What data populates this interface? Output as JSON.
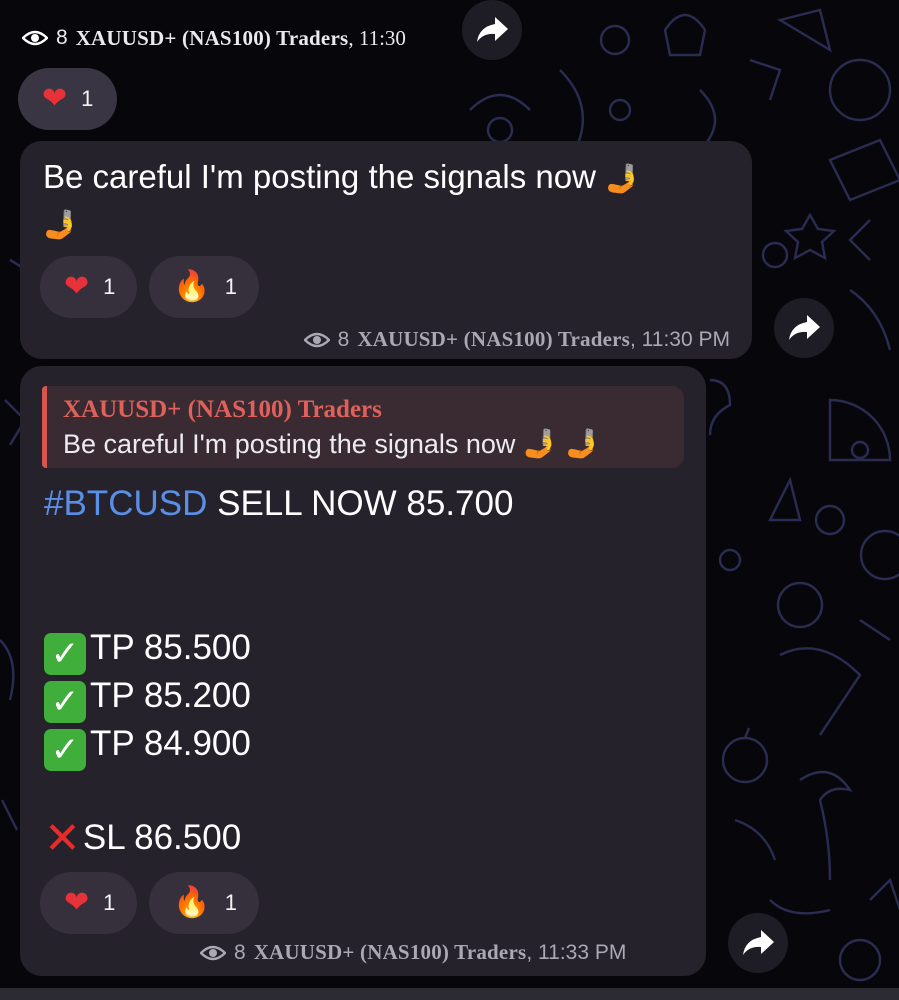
{
  "colors": {
    "background": "#07070b",
    "bubble": "#25222c",
    "accent_link": "#5a8fe8",
    "quote_accent": "#d7554f"
  },
  "top_meta": {
    "icon": "eye-icon",
    "views": "8",
    "channel": "XAUUSD+ (NAS100) Traders",
    "time": ", 11:30"
  },
  "top_reaction": {
    "icon": "heart-icon",
    "emoji": "❤",
    "count": "1"
  },
  "message1": {
    "text": "Be careful I'm posting the signals now",
    "trailing_emoji": "🤳",
    "reactions": [
      {
        "icon": "heart-icon",
        "emoji": "❤",
        "count": "1"
      },
      {
        "icon": "fire-icon",
        "emoji": "🔥",
        "count": "1"
      }
    ],
    "meta": {
      "views": "8",
      "channel": "XAUUSD+ (NAS100) Traders",
      "time": ", 11:30 PM"
    }
  },
  "message2": {
    "reply": {
      "author": "XAUUSD+ (NAS100) Traders",
      "text": "Be careful I'm posting the signals now"
    },
    "signal": {
      "hashtag": "#BTCUSD",
      "rest": " SELL NOW 85.700",
      "targets": [
        "TP 85.500",
        "TP 85.200",
        "TP 84.900"
      ],
      "stop_loss": "SL 86.500"
    },
    "reactions": [
      {
        "icon": "heart-icon",
        "emoji": "❤",
        "count": "1"
      },
      {
        "icon": "fire-icon",
        "emoji": "🔥",
        "count": "1"
      }
    ],
    "meta": {
      "views": "8",
      "channel": "XAUUSD+ (NAS100) Traders",
      "time": ", 11:33 PM"
    }
  },
  "forward_icon": "share-arrow-icon"
}
